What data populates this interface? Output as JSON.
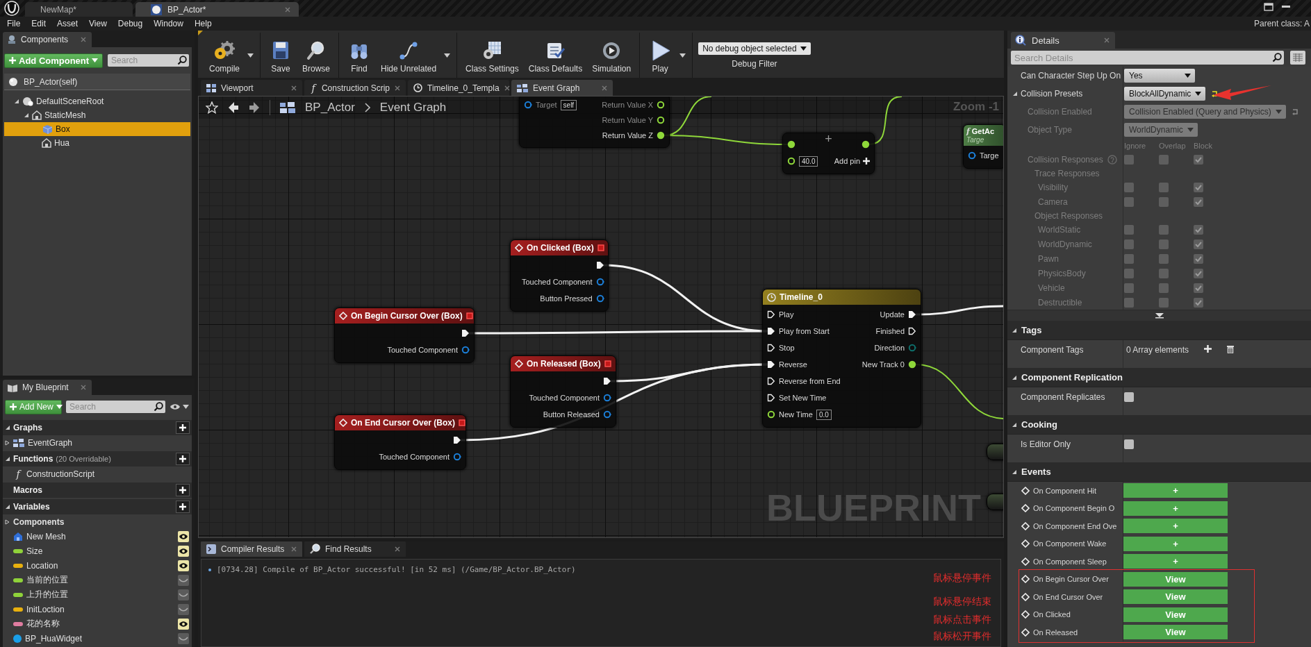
{
  "title_bar": {
    "tabs": [
      {
        "label": "NewMap*",
        "selected": false
      },
      {
        "label": "BP_Actor*",
        "selected": true
      }
    ]
  },
  "menu_bar": {
    "items": [
      "File",
      "Edit",
      "Asset",
      "View",
      "Debug",
      "Window",
      "Help"
    ],
    "parent_class": "Parent class: A"
  },
  "components": {
    "title": "Components",
    "add_button": "Add Component",
    "search_placeholder": "Search",
    "root": "BP_Actor(self)",
    "tree": [
      {
        "label": "DefaultSceneRoot",
        "kind": "scene",
        "expanded": true,
        "selected": false,
        "children": [
          {
            "label": "StaticMesh",
            "kind": "mesh",
            "expanded": true,
            "selected": false,
            "children": [
              {
                "label": "Box",
                "kind": "box",
                "selected": true
              },
              {
                "label": "Hua",
                "kind": "mesh",
                "selected": false
              }
            ]
          }
        ]
      }
    ]
  },
  "my_blueprint": {
    "title": "My Blueprint",
    "add_button": "Add New",
    "search_placeholder": "Search",
    "sections": [
      {
        "label": "Graphs",
        "expanded": true,
        "items": [
          {
            "label": "EventGraph",
            "kind": "graph",
            "expanded": false
          }
        ]
      },
      {
        "label": "Functions",
        "note": "(20 Overridable)",
        "expanded": true,
        "items": [
          {
            "label": "ConstructionScript",
            "kind": "function",
            "glyph": "f"
          }
        ]
      },
      {
        "label": "Macros"
      },
      {
        "label": "Variables",
        "expanded": true,
        "items": [
          {
            "label": "Components",
            "kind": "category",
            "expanded": false
          },
          {
            "label": "New Mesh",
            "kind": "component",
            "public": true
          },
          {
            "label": "Size",
            "kind": "variable",
            "color": "#8fd23a",
            "public": true
          },
          {
            "label": "Location",
            "kind": "variable",
            "color": "#e8b00e",
            "public": true
          },
          {
            "label": "当前的位置",
            "kind": "variable",
            "color": "#8fd23a",
            "public": false
          },
          {
            "label": "上升的位置",
            "kind": "variable",
            "color": "#8fd23a",
            "public": false
          },
          {
            "label": "InitLoction",
            "kind": "variable",
            "color": "#e8b00e",
            "public": false
          },
          {
            "label": "花的名称",
            "kind": "variable",
            "color": "#e07ca0",
            "public": true
          },
          {
            "label": "BP_HuaWidget",
            "kind": "object",
            "color": "#1a9fe8",
            "public": false
          }
        ]
      }
    ]
  },
  "toolbar": {
    "groups": [
      {
        "buttons": [
          {
            "label": "Compile",
            "kind": "compile",
            "dropdown": true
          }
        ]
      },
      {
        "buttons": [
          {
            "label": "Save",
            "kind": "save",
            "dropdown": false
          },
          {
            "label": "Browse",
            "kind": "browse",
            "dropdown": false
          }
        ]
      },
      {
        "buttons": [
          {
            "label": "Find",
            "kind": "find",
            "dropdown": false
          },
          {
            "label": "Hide Unrelated",
            "kind": "hide_unrelated",
            "dropdown": true
          }
        ]
      },
      {
        "buttons": [
          {
            "label": "Class Settings",
            "kind": "class_settings",
            "dropdown": false
          },
          {
            "label": "Class Defaults",
            "kind": "class_defaults",
            "dropdown": false
          },
          {
            "label": "Simulation",
            "kind": "simulation",
            "dropdown": false
          }
        ]
      },
      {
        "buttons": [
          {
            "label": "Play",
            "kind": "play",
            "dropdown": true
          }
        ]
      }
    ],
    "debug_filter": {
      "value": "No debug object selected",
      "label": "Debug Filter"
    }
  },
  "doc_tabs": [
    {
      "label": "Viewport",
      "kind": "viewport",
      "selected": false
    },
    {
      "label": "Construction Scrip",
      "kind": "function",
      "glyph": "f",
      "selected": false
    },
    {
      "label": "Timeline_0_Templa",
      "kind": "timeline",
      "selected": false
    },
    {
      "label": "Event Graph",
      "kind": "graph",
      "selected": true
    }
  ],
  "graph": {
    "breadcrumb": [
      "BP_Actor",
      "Event Graph"
    ],
    "zoom": "Zoom -1",
    "watermark": "BLUEPRINT",
    "nodes": [
      {
        "kind": "pure",
        "inputs": [
          {
            "label": "Target",
            "kind": "object",
            "connected": false,
            "value": "self"
          }
        ],
        "outputs": [
          {
            "label": "Return Value X",
            "kind": "float",
            "connected": false
          },
          {
            "label": "Return Value Y",
            "kind": "float",
            "connected": false
          },
          {
            "label": "Return Value Z",
            "kind": "float",
            "connected": true
          }
        ]
      },
      {
        "kind": "math",
        "symbol": "+",
        "add_pin": "Add pin",
        "inputs": [
          {
            "kind": "float",
            "connected": true
          },
          {
            "kind": "float",
            "connected": false,
            "value": "40.0"
          }
        ],
        "outputs": [
          {
            "kind": "float",
            "connected": true
          }
        ]
      },
      {
        "kind": "function",
        "glyph": "f",
        "title": "GetAc",
        "subtitle": "Targe",
        "inputs": [
          {
            "label": "Targe",
            "kind": "object",
            "connected": false
          }
        ]
      },
      {
        "kind": "event",
        "title": "On Clicked (Box)",
        "outputs": [
          {
            "kind": "exec",
            "connected": true
          },
          {
            "label": "Touched Component",
            "kind": "object",
            "connected": false
          },
          {
            "label": "Button Pressed",
            "kind": "object",
            "connected": false
          }
        ]
      },
      {
        "kind": "timeline",
        "title": "Timeline_0",
        "inputs": [
          {
            "label": "Play",
            "kind": "exec",
            "connected": false
          },
          {
            "label": "Play from Start",
            "kind": "exec",
            "connected": true
          },
          {
            "label": "Stop",
            "kind": "exec",
            "connected": false
          },
          {
            "label": "Reverse",
            "kind": "exec",
            "connected": true
          },
          {
            "label": "Reverse from End",
            "kind": "exec",
            "connected": false
          },
          {
            "label": "Set New Time",
            "kind": "exec",
            "connected": false
          },
          {
            "label": "New Time",
            "kind": "float",
            "connected": false,
            "value": "0.0"
          }
        ],
        "outputs": [
          {
            "label": "Update",
            "kind": "exec",
            "connected": true
          },
          {
            "label": "Finished",
            "kind": "exec",
            "connected": false
          },
          {
            "label": "Direction",
            "kind": "enum",
            "connected": false
          },
          {
            "label": "New Track 0",
            "kind": "float",
            "connected": true
          }
        ]
      },
      {
        "kind": "event",
        "title": "On Begin Cursor Over (Box)",
        "outputs": [
          {
            "kind": "exec",
            "connected": true
          },
          {
            "label": "Touched Component",
            "kind": "object",
            "connected": false
          }
        ]
      },
      {
        "kind": "event",
        "title": "On Released (Box)",
        "outputs": [
          {
            "kind": "exec",
            "connected": true
          },
          {
            "label": "Touched Component",
            "kind": "object",
            "connected": false
          },
          {
            "label": "Button Released",
            "kind": "object",
            "connected": false
          }
        ]
      },
      {
        "kind": "event",
        "title": "On End Cursor Over (Box)",
        "outputs": [
          {
            "kind": "exec",
            "connected": true
          },
          {
            "label": "Touched Component",
            "kind": "object",
            "connected": false
          }
        ]
      },
      {
        "kind": "partial"
      },
      {
        "kind": "partial"
      }
    ]
  },
  "results": {
    "tabs": [
      {
        "label": "Compiler Results",
        "kind": "compiler",
        "selected": true
      },
      {
        "label": "Find Results",
        "kind": "find",
        "selected": false
      }
    ],
    "messages": [
      "[0734.28] Compile of BP_Actor successful! [in 52 ms] (/Game/BP_Actor.BP_Actor)"
    ]
  },
  "details": {
    "title": "Details",
    "search_placeholder": "Search Details",
    "rows": [
      {
        "kind": "dropdown",
        "label": "Can Character Step Up On",
        "value": "Yes"
      },
      {
        "kind": "dropdown",
        "label": "Collision Presets",
        "value": "BlockAllDynamic",
        "reset": true,
        "expanded": true,
        "children": [
          {
            "kind": "dropdown",
            "label": "Collision Enabled",
            "value": "Collision Enabled (Query and Physics)",
            "reset": true,
            "disabled": true
          },
          {
            "kind": "dropdown",
            "label": "Object Type",
            "value": "WorldDynamic",
            "disabled": true
          },
          {
            "kind": "columns_header",
            "labels": [
              "Ignore",
              "Overlap",
              "Block"
            ],
            "disabled": true
          },
          {
            "kind": "checks",
            "label": "Collision Responses",
            "help": true,
            "disabled": true,
            "checks": [
              {
                "checked": false
              },
              {
                "checked": false
              },
              {
                "checked": true
              }
            ]
          },
          {
            "kind": "group",
            "label": "Trace Responses",
            "disabled": true,
            "children": [
              {
                "kind": "checks",
                "label": "Visibility",
                "disabled": true,
                "checks": [
                  {
                    "checked": false
                  },
                  {
                    "checked": false
                  },
                  {
                    "checked": true
                  }
                ]
              },
              {
                "kind": "checks",
                "label": "Camera",
                "disabled": true,
                "checks": [
                  {
                    "checked": false
                  },
                  {
                    "checked": false
                  },
                  {
                    "checked": true
                  }
                ]
              }
            ]
          },
          {
            "kind": "group",
            "label": "Object Responses",
            "disabled": true,
            "children": [
              {
                "kind": "checks",
                "label": "WorldStatic",
                "disabled": true,
                "checks": [
                  {
                    "checked": false
                  },
                  {
                    "checked": false
                  },
                  {
                    "checked": true
                  }
                ]
              },
              {
                "kind": "checks",
                "label": "WorldDynamic",
                "disabled": true,
                "checks": [
                  {
                    "checked": false
                  },
                  {
                    "checked": false
                  },
                  {
                    "checked": true
                  }
                ]
              },
              {
                "kind": "checks",
                "label": "Pawn",
                "disabled": true,
                "checks": [
                  {
                    "checked": false
                  },
                  {
                    "checked": false
                  },
                  {
                    "checked": true
                  }
                ]
              },
              {
                "kind": "checks",
                "label": "PhysicsBody",
                "disabled": true,
                "checks": [
                  {
                    "checked": false
                  },
                  {
                    "checked": false
                  },
                  {
                    "checked": true
                  }
                ]
              },
              {
                "kind": "checks",
                "label": "Vehicle",
                "disabled": true,
                "checks": [
                  {
                    "checked": false
                  },
                  {
                    "checked": false
                  },
                  {
                    "checked": true
                  }
                ]
              },
              {
                "kind": "checks",
                "label": "Destructible",
                "disabled": true,
                "checks": [
                  {
                    "checked": false
                  },
                  {
                    "checked": false
                  },
                  {
                    "checked": true
                  }
                ]
              }
            ]
          }
        ]
      }
    ],
    "sections": [
      {
        "label": "Tags",
        "expanded": true,
        "rows": [
          {
            "kind": "array",
            "label": "Component Tags",
            "value": "0 Array elements"
          }
        ]
      },
      {
        "label": "Component Replication",
        "expanded": true,
        "rows": [
          {
            "kind": "checkbox",
            "label": "Component Replicates",
            "checked": false
          }
        ]
      },
      {
        "label": "Cooking",
        "expanded": true,
        "rows": [
          {
            "kind": "checkbox",
            "label": "Is Editor Only",
            "checked": false
          }
        ]
      },
      {
        "label": "Events",
        "expanded": true,
        "rows": [
          {
            "kind": "event",
            "label": "On Component Hit",
            "button": "+"
          },
          {
            "kind": "event",
            "label": "On Component Begin O",
            "button": "+"
          },
          {
            "kind": "event",
            "label": "On Component End Ove",
            "button": "+"
          },
          {
            "kind": "event",
            "label": "On Component Wake",
            "button": "+"
          },
          {
            "kind": "event",
            "label": "On Component Sleep",
            "button": "+"
          },
          {
            "kind": "event",
            "label": "On Begin Cursor Over",
            "button": "View"
          },
          {
            "kind": "event",
            "label": "On End Cursor Over",
            "button": "View"
          },
          {
            "kind": "event",
            "label": "On Clicked",
            "button": "View"
          },
          {
            "kind": "event",
            "label": "On Released",
            "button": "View"
          }
        ]
      }
    ]
  },
  "annotations": {
    "notes": [
      "鼠标悬停事件",
      "鼠标悬停结束",
      "鼠标点击事件",
      "鼠标松开事件"
    ]
  }
}
